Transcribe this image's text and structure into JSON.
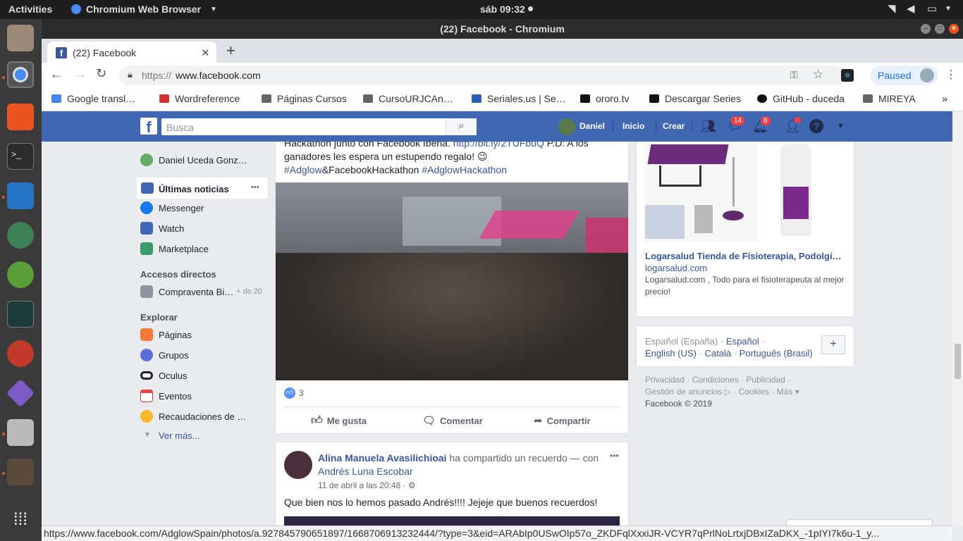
{
  "system_bar": {
    "activities": "Activities",
    "app_name": "Chromium Web Browser",
    "clock": "sáb 09:32"
  },
  "window": {
    "title": "(22) Facebook - Chromium"
  },
  "tab": {
    "title": "(22) Facebook",
    "new_tab": "+"
  },
  "omnibox": {
    "scheme": "https://",
    "host": "www.facebook.com",
    "paused_label": "Paused"
  },
  "bookmarks": [
    "Google transl…",
    "Wordreference",
    "Páginas Cursos",
    "CursoURJCAn…",
    "Seriales.us | Se…",
    "ororo.tv",
    "Descargar Series",
    "GitHub - duceda",
    "MIREYA"
  ],
  "bookmarks_more": "»",
  "fb_header": {
    "search_placeholder": "Busca",
    "user": "Daniel",
    "home": "Inicio",
    "create": "Crear",
    "messages_badge": "14",
    "notifications_badge": "8"
  },
  "left_nav": {
    "profile": "Daniel Uceda Gonz…",
    "items": [
      "Últimas noticias",
      "Messenger",
      "Watch",
      "Marketplace"
    ],
    "more_dots": "•••",
    "shortcuts_title": "Accesos directos",
    "shortcut": "Compraventa Bi…",
    "shortcut_count": "+ de 20",
    "explore_title": "Explorar",
    "explore": [
      "Páginas",
      "Grupos",
      "Oculus",
      "Eventos",
      "Recaudaciones de …"
    ],
    "see_more": "Ver más..."
  },
  "post1": {
    "text_line1_a": "Hackathon junto con Facebook Iberia. ",
    "text_line1_link": "http://bit.ly/2TUFbuQ",
    "text_line1_b": " P.D: A los",
    "text_line2": "ganadores les espera un estupendo regalo! 😉",
    "hashtag1": "#Adglow",
    "text_mid": "&FacebookHackathon ",
    "hashtag2": "#AdglowHackathon",
    "reactions": "3",
    "like": "Me gusta",
    "comment": "Comentar",
    "share": "Compartir"
  },
  "post2": {
    "author": "Alina Manuela Avasilichioai",
    "action": " ha compartido un recuerdo — con",
    "tagged": "Andrés Luna Escobar",
    "time": "11 de abril a las 20:48 · ",
    "text": "Que bien nos lo hemos pasado Andrés!!!! Jejeje que buenos recuerdos!",
    "menu": "•••"
  },
  "ad": {
    "title": "Logarsalud Tienda de Fisioterapia, Podolgí…",
    "domain": "logarsalud.com",
    "desc": "Logarsalud.com , Todo para el fisioterapeuta al mejor precio!"
  },
  "languages": {
    "current": "Español (España)",
    "sep": " · ",
    "l1": "Español",
    "l2": "English (US)",
    "l3": "Català",
    "l4": "Português (Brasil)",
    "add": "+"
  },
  "footer": {
    "links_line1": "Privacidad · Condiciones · Publicidad ·",
    "links_line2": "Gestión de anuncios ▷ · Cookies · Más ▾",
    "copyright": "Facebook © 2019"
  },
  "status_url": "https://www.facebook.com/AdglowSpain/photos/a.927845790651897/1668706913232444/?type=3&eid=ARAbIp0USwOIp57o_ZKDFqlXxxiJR-VCYR7qPrlNoLrtxjDBxIZaDKX_-1pIYI7k6u-1_y...",
  "colors": {
    "fb_blue": "#4267b2",
    "link": "#385898",
    "ubuntu_orange": "#e95420"
  }
}
